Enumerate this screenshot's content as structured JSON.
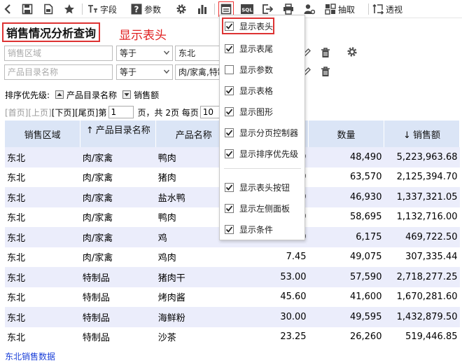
{
  "toolbar": {
    "field_label": "字段",
    "param_label": "参数",
    "sql_label": "SQL",
    "extract_label": "抽取",
    "pivot_label": "透视"
  },
  "title": "销售情况分析查询",
  "title_annotation": "显示表头",
  "filters": [
    {
      "field_placeholder": "销售区域",
      "operator": "等于",
      "value": "东北"
    },
    {
      "field_placeholder": "产品目录名称",
      "operator": "等于",
      "value": "肉/家禽,特制"
    }
  ],
  "sort": {
    "label": "排序优先级:",
    "items": [
      "产品目录名称",
      "销售额"
    ]
  },
  "pager": {
    "first": "[首页]",
    "prev": "[上页]",
    "next": "[下页]",
    "last": "[尾页]",
    "page_prefix": "第",
    "page_value": "1",
    "page_suffix": "页，共 2页 每页",
    "per_page_value": "10"
  },
  "table": {
    "headers": [
      "销售区域",
      "产品目录名称",
      "产品名称",
      "",
      "数量",
      "销售额"
    ],
    "rows": [
      [
        "东北",
        "肉/家禽",
        "鸭肉",
        "",
        "48,490",
        "5,223,963.68"
      ],
      [
        "东北",
        "肉/家禽",
        "猪肉",
        "",
        "63,570",
        "2,125,394.70"
      ],
      [
        "东北",
        "肉/家禽",
        "盐水鸭",
        "",
        "46,930",
        "1,337,321.05"
      ],
      [
        "东北",
        "肉/家禽",
        "鸭肉",
        "",
        "58,695",
        "1,132,716.00"
      ],
      [
        "东北",
        "肉/家禽",
        "鸡",
        "",
        "6,175",
        "469,722.50"
      ],
      [
        "东北",
        "肉/家禽",
        "鸡肉",
        "7.45",
        "49,075",
        "307,335.44"
      ],
      [
        "东北",
        "特制品",
        "猪肉干",
        "53.00",
        "57,590",
        "2,718,277.25"
      ],
      [
        "东北",
        "特制品",
        "烤肉酱",
        "45.60",
        "41,600",
        "1,670,281.60"
      ],
      [
        "东北",
        "特制品",
        "海鲜粉",
        "30.00",
        "49,595",
        "1,432,879.50"
      ],
      [
        "东北",
        "特制品",
        "沙茶",
        "23.25",
        "26,260",
        "519,446.85"
      ]
    ],
    "partial_cells": [
      "9",
      "0",
      "0",
      "0",
      "0"
    ]
  },
  "footer_link": "东北销售数据",
  "menu": {
    "items": [
      {
        "label": "显示表头",
        "checked": true
      },
      {
        "label": "显示表尾",
        "checked": true
      },
      {
        "label": "显示参数",
        "checked": false
      },
      {
        "label": "显示表格",
        "checked": true
      },
      {
        "label": "显示图形",
        "checked": true
      },
      {
        "label": "显示分页控制器",
        "checked": true
      },
      {
        "label": "显示排序优先级",
        "checked": true
      },
      {
        "label": "显示表头按钮",
        "checked": true
      },
      {
        "label": "显示左侧面板",
        "checked": true
      },
      {
        "label": "显示条件",
        "checked": true
      }
    ]
  },
  "colors": {
    "header_bg": "#dbe5f6",
    "alt_row_bg": "#ebedfb",
    "highlight_red": "#dd3333",
    "link_blue": "#1a3fd8"
  }
}
